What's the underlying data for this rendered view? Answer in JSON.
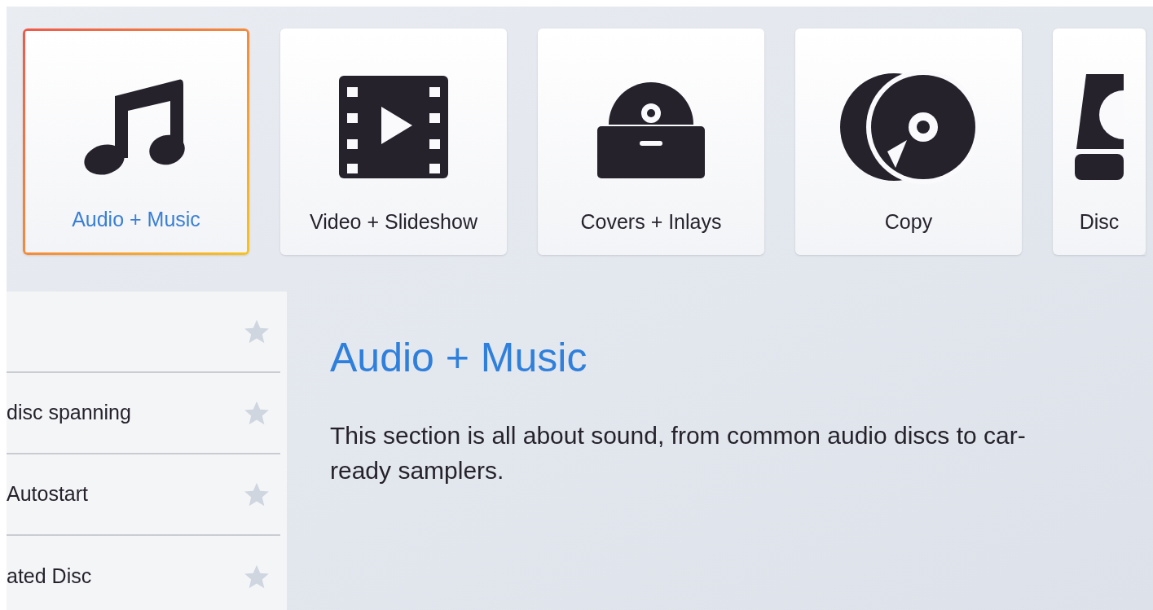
{
  "categories": [
    {
      "label": "Audio + Music",
      "kind": "music",
      "selected": true
    },
    {
      "label": "Video + Slideshow",
      "kind": "film",
      "selected": false
    },
    {
      "label": "Covers + Inlays",
      "kind": "cover",
      "selected": false
    },
    {
      "label": "Copy",
      "kind": "copy",
      "selected": false
    },
    {
      "label": "Disc",
      "kind": "drive",
      "selected": false
    }
  ],
  "project_list": [
    {
      "favorite": false
    },
    {
      "label": "disc spanning",
      "favorite": false
    },
    {
      "label": "Autostart",
      "favorite": false
    },
    {
      "label": "ated Disc",
      "favorite": false
    }
  ],
  "section": {
    "title": "Audio + Music",
    "description": "This section is all about sound, from common audio discs to car-ready samplers."
  }
}
